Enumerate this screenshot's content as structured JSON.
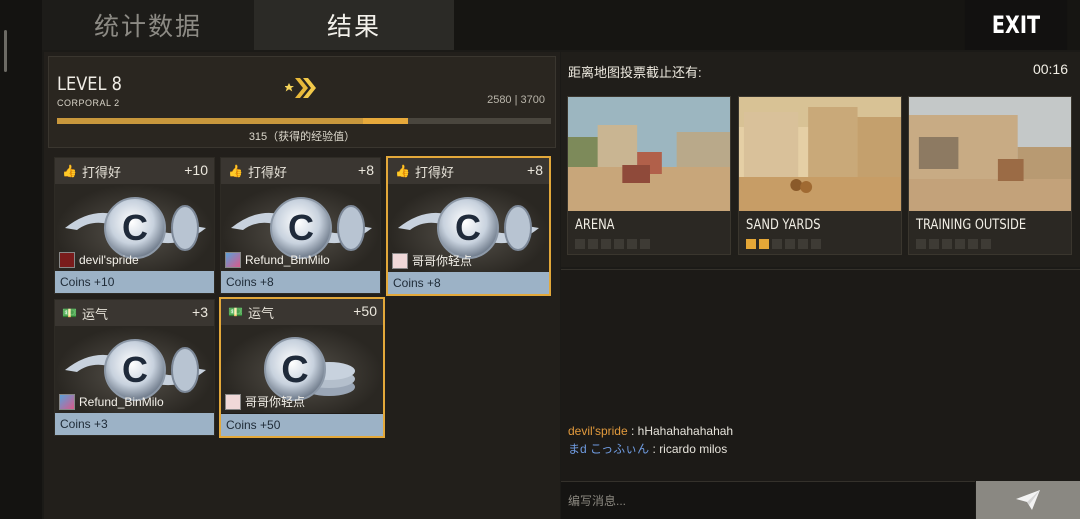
{
  "tabs": {
    "stats": "统计数据",
    "results": "结果"
  },
  "exit_label": "EXIT",
  "level": {
    "title": "LEVEL 8",
    "rank": "CORPORAL 2",
    "xp": "2580 | 3700",
    "xp_base_fraction": 0.62,
    "xp_gain_fraction": 0.09,
    "xp_caption": "315（获得的经验值）"
  },
  "cards": [
    {
      "label": "打得好",
      "bonus": "+10",
      "player": "devil'spride",
      "coins": "Coins +10",
      "icon": "thumbs-up-icon"
    },
    {
      "label": "打得好",
      "bonus": "+8",
      "player": "Refund_BinMilo",
      "coins": "Coins +8",
      "icon": "thumbs-up-icon"
    },
    {
      "label": "打得好",
      "bonus": "+8",
      "player": "哥哥你轻点",
      "coins": "Coins +8",
      "icon": "thumbs-up-icon"
    },
    {
      "label": "运气",
      "bonus": "+3",
      "player": "Refund_BinMilo",
      "coins": "Coins +3",
      "icon": "money-icon"
    },
    {
      "label": "运气",
      "bonus": "+50",
      "player": "哥哥你轻点",
      "coins": "Coins +50",
      "icon": "money-icon"
    }
  ],
  "vote": {
    "title": "距离地图投票截止还有:",
    "timer": "00:16",
    "maps": [
      {
        "name": "ARENA",
        "votes": 0
      },
      {
        "name": "SAND YARDS",
        "votes": 2
      },
      {
        "name": "TRAINING OUTSIDE",
        "votes": 0
      }
    ]
  },
  "chat": {
    "messages": [
      {
        "user": "devil'spride",
        "sep": " : ",
        "text": "hHahahahahahah",
        "user_color": "#e29a3d"
      },
      {
        "user": "まd こっふぃん",
        "sep": " : ",
        "text": "ricardo milos",
        "user_color": "#6f9be0"
      }
    ],
    "placeholder": "编写消息..."
  },
  "colors": {
    "accent": "#e3a83a",
    "coin_footer": "#9cb2c6"
  }
}
